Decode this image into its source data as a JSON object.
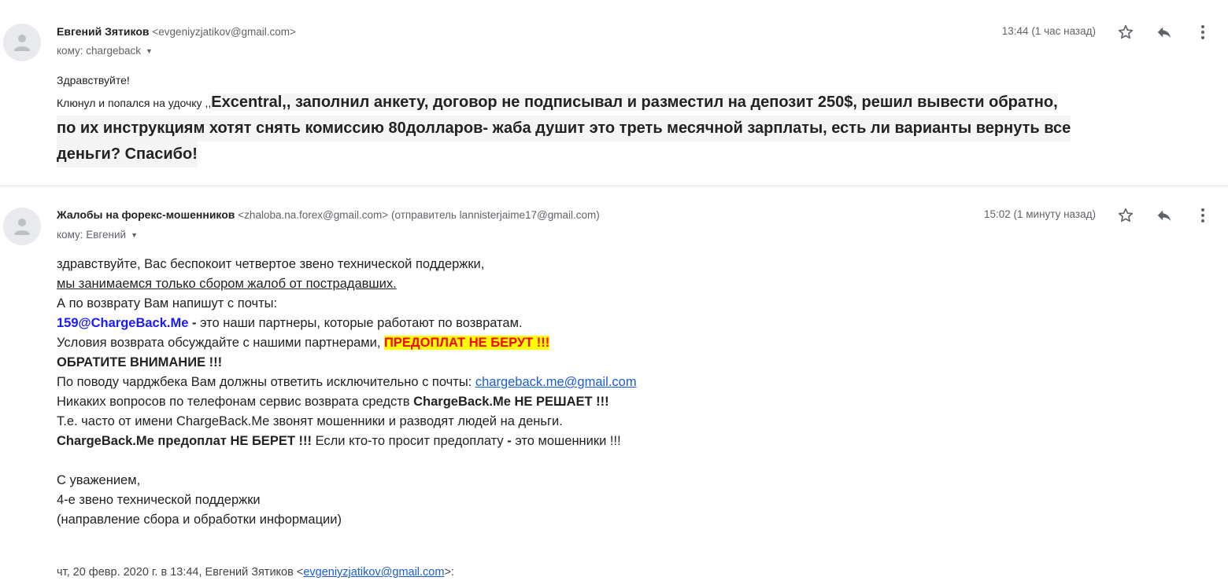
{
  "messages": [
    {
      "sender_name": "Евгений Зятиков",
      "sender_email": "<evgeniyzjatikov@gmail.com>",
      "sender_extra": "",
      "recipient": "кому: chargeback",
      "time": "13:44 (1 час назад)",
      "body": {
        "greeting": "Здравствуйте!",
        "lead_small": "Клюнул и попался на удочку ,,",
        "lead_big": "Excentral,, заполнил анкету, договор не подписывал и разместил на депозит 250$, решил вывести обратно,",
        "line2": "по их инструкциям хотят снять комиссию 80долларов- жаба душит это треть месячной зарплаты, есть ли варианты вернуть все",
        "line3": "деньги? Спасибо!"
      }
    },
    {
      "sender_name": "Жалобы на форекс-мошенников",
      "sender_email": "<zhaloba.na.forex@gmail.com>",
      "sender_extra": "(отправитель lannisterjaime17@gmail.com)",
      "recipient": "кому: Евгений",
      "time": "15:02 (1 минуту назад)",
      "body": {
        "l1": "здравствуйте, Вас беспокоит четвертое звено технической поддержки,",
        "l2": "мы занимаемся только сбором жалоб от пострадавших.",
        "l3": "А по возврату Вам напишут с почты:",
        "l4_email": "159@ChargeBack.Me",
        "l4_dash": " - ",
        "l4_rest": "это наши партнеры, которые работают по возвратам.",
        "l5_text": "Условия возврата обсуждайте с нашими партнерами, ",
        "l5_highlight": "ПРЕДОПЛАТ НЕ БЕРУТ !!!",
        "l6": "ОБРАТИТЕ ВНИМАНИЕ !!!",
        "l7_text": "По поводу чарджбека Вам должны ответить исключительно с почты: ",
        "l7_link": "chargeback.me@gmail.com",
        "l8_text": "Никаких вопросов по телефонам сервис возврата средств ",
        "l8_bold": "ChargeBack.Me НЕ РЕШАЕТ !!!",
        "l9": "Т.е. часто от имени ChargeBack.Me звонят мошенники и разводят людей на деньги.",
        "l10_bold": "ChargeBack.Me предоплат НЕ БЕРЕТ !!!",
        "l10_text": " Если кто-то просит предоплату ",
        "l10_dash": "-",
        "l10_rest": " это мошенники !!!",
        "sig1": "С уважением,",
        "sig2": "4-е звено технической поддержки",
        "sig3": "(направление сбора и обработки информации)"
      },
      "quote": {
        "prefix": "чт, 20 февр. 2020 г. в 13:44, Евгений Зятиков <",
        "email": "evgeniyzjatikov@gmail.com",
        "suffix": ">:"
      }
    }
  ],
  "icons": [
    "person-avatar-icon",
    "star-icon",
    "reply-icon",
    "more-vert-icon",
    "chevron-down-icon"
  ],
  "colors": {
    "highlight_bg": "#ffff00",
    "highlight_text": "#ff0000",
    "email_blue": "#1a1aff",
    "link_blue": "#1a5bd6"
  }
}
